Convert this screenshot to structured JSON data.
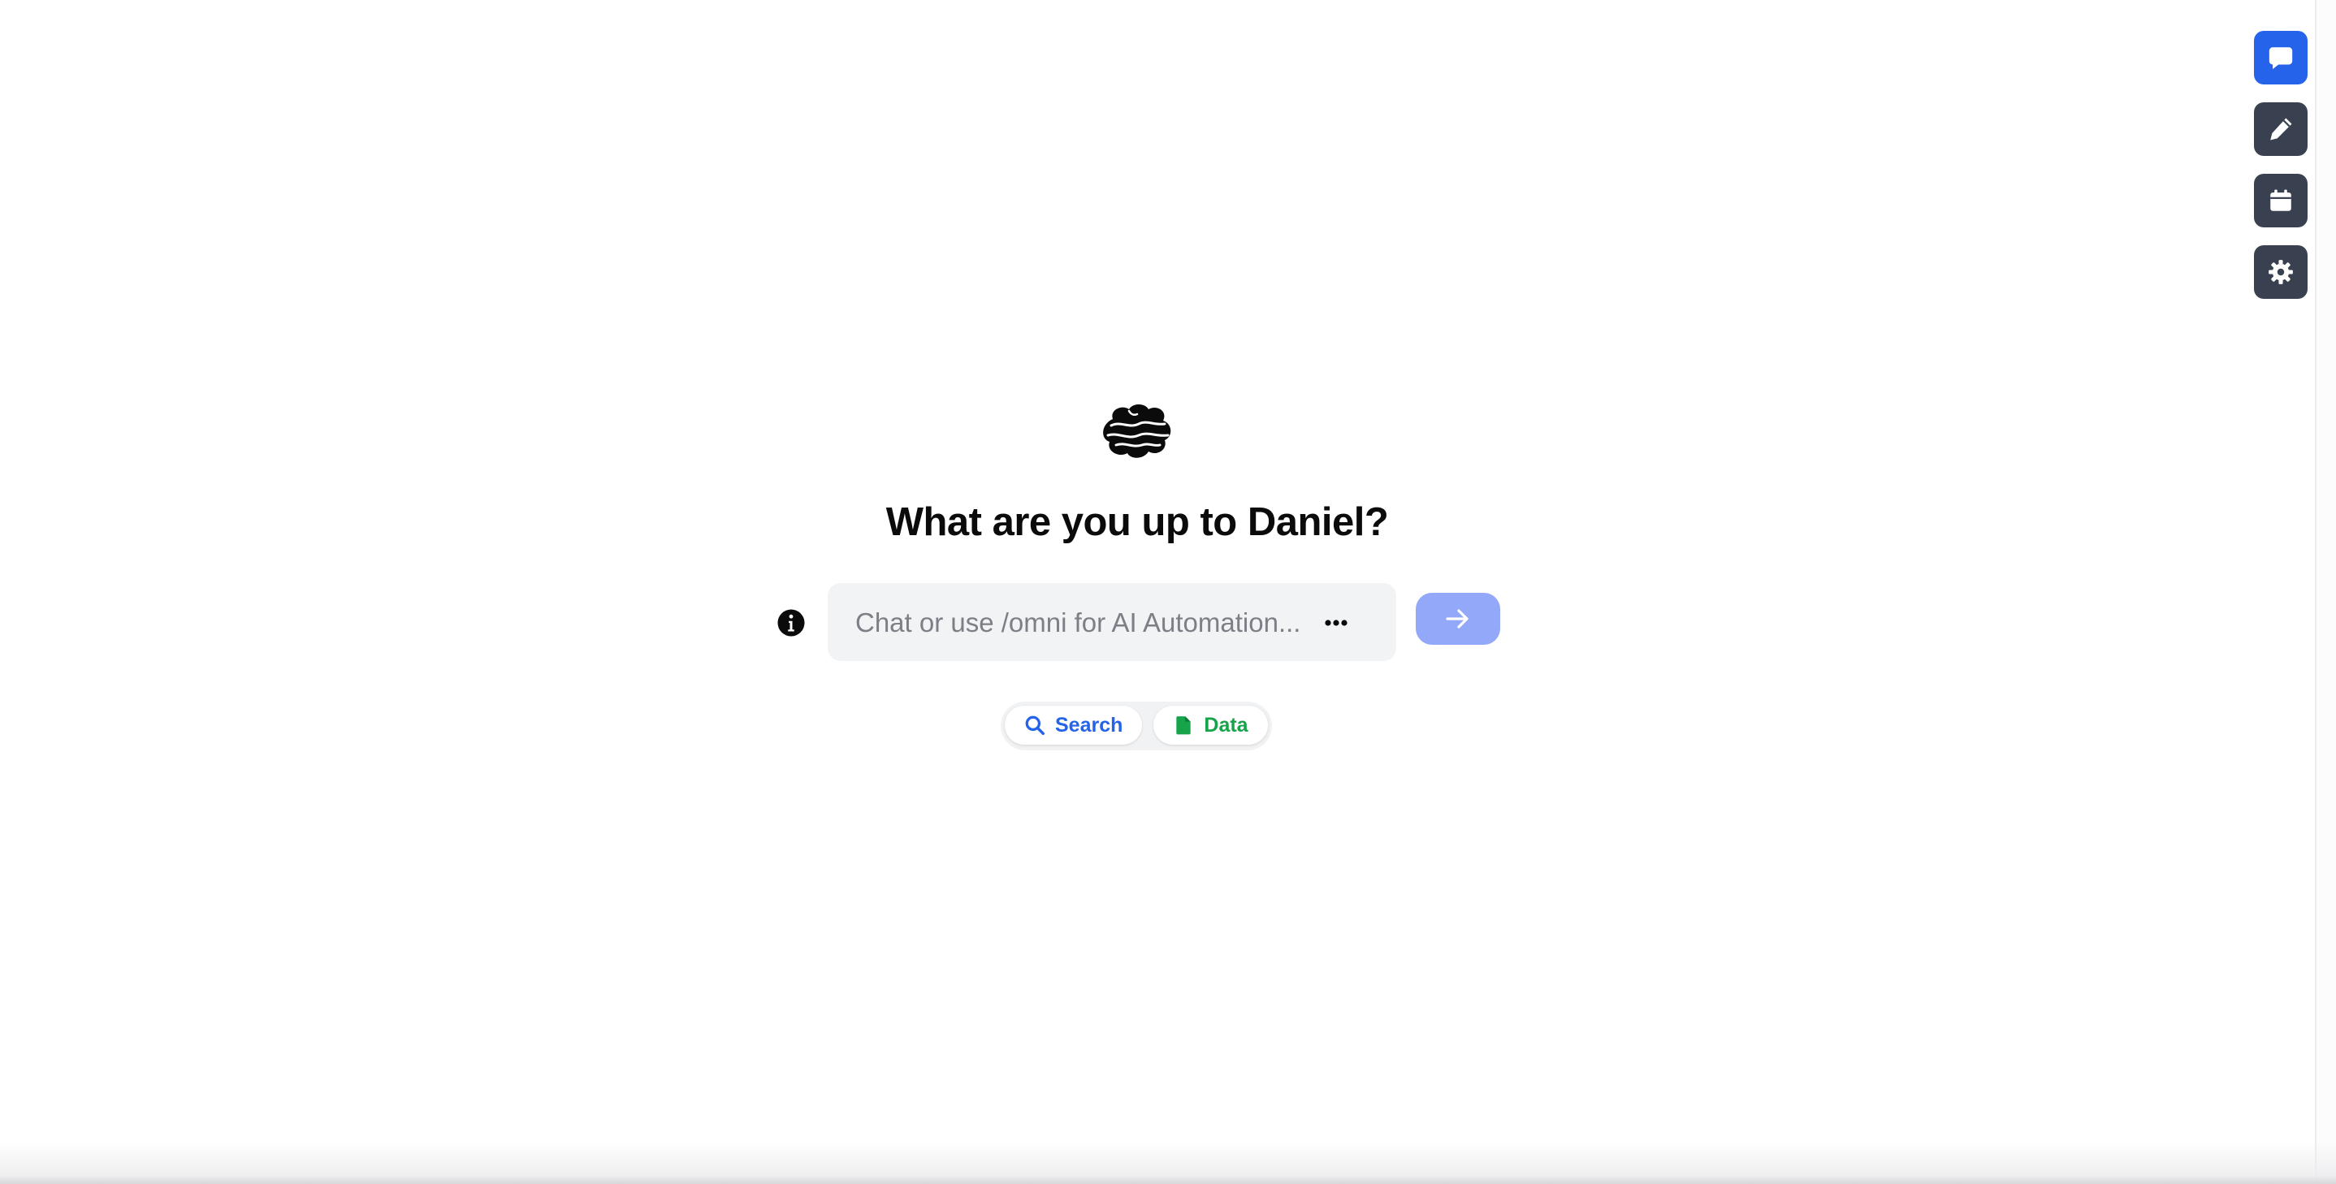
{
  "greeting": "What are you up to Daniel?",
  "chat": {
    "placeholder": "Chat or use /omni for AI Automation...",
    "value": ""
  },
  "chips": [
    {
      "label": "Search",
      "icon": "search-icon",
      "color": "#2563eb"
    },
    {
      "label": "Data",
      "icon": "file-icon",
      "color": "#16a34a"
    }
  ],
  "rail": [
    {
      "name": "chat",
      "icon": "chat-bubble-icon",
      "active": true
    },
    {
      "name": "edit",
      "icon": "pencil-icon",
      "active": false
    },
    {
      "name": "calendar",
      "icon": "calendar-icon",
      "active": false
    },
    {
      "name": "settings",
      "icon": "gear-icon",
      "active": false
    }
  ],
  "colors": {
    "accent": "#2563eb",
    "rail_button": "#394150",
    "send_button": "#93a8f9",
    "input_background": "#f2f3f5",
    "data_chip": "#16a34a"
  },
  "logo": "brain-icon"
}
